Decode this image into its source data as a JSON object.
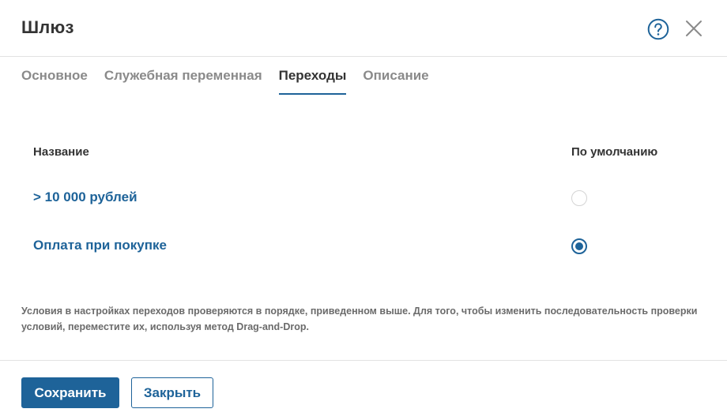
{
  "dialog": {
    "title": "Шлюз"
  },
  "icons": {
    "help": "help-circle-icon",
    "close": "close-icon"
  },
  "colors": {
    "accent": "#1e6399",
    "text": "#333333",
    "muted": "#8a8a8a",
    "divider": "#e2e2e2"
  },
  "tabs": [
    {
      "label": "Основное",
      "active": false
    },
    {
      "label": "Служебная переменная",
      "active": false
    },
    {
      "label": "Переходы",
      "active": true
    },
    {
      "label": "Описание",
      "active": false
    }
  ],
  "transitions": {
    "columns": {
      "name": "Название",
      "default": "По умолчанию"
    },
    "rows": [
      {
        "label": "> 10 000 рублей",
        "default": false
      },
      {
        "label": "Оплата при покупке",
        "default": true
      }
    ],
    "note": "Условия в настройках переходов проверяются в порядке, приведенном выше. Для того, чтобы изменить последовательность проверки условий, переместите их, используя метод Drag-and-Drop."
  },
  "footer": {
    "save_label": "Сохранить",
    "close_label": "Закрыть"
  }
}
